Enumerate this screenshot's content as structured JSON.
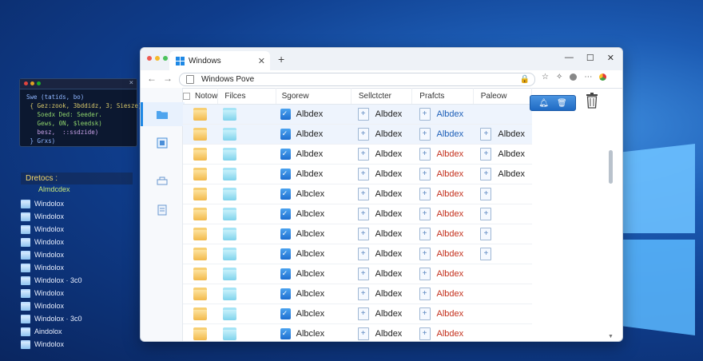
{
  "terminal": {
    "lines": [
      "Swe (tatids, bo)",
      " { Gez:zook, 3bddidz, 3; Siesze)",
      "   Soedx Ded: Seeder.",
      "   Gews, 0N, $leedsk)",
      "   besz,  ::ssdzide)",
      " } Grxs)"
    ],
    "line_colors": [
      "#8fb6ff",
      "#d8c86a",
      "#8ed36b",
      "#8ed36b",
      "#c7a0e6",
      "#8fb6ff"
    ]
  },
  "desktop_panel": {
    "header": "Dretocs :",
    "subheader": "Almdcdex",
    "items": [
      "Windolox",
      "Windolox",
      "Windolox",
      "Windolox",
      "Windolox",
      "Windolox",
      "Windolox · 3c0",
      "Windolox",
      "Windolox",
      "Windolox · 3c0",
      "Aindolox",
      "Windolox"
    ]
  },
  "browser": {
    "tab_title": "Windows",
    "address": "Windows Pove",
    "controls": {
      "minimize": "—",
      "maximize": "☐",
      "close": "✕",
      "new_tab": "+",
      "tab_close": "✕"
    }
  },
  "grid": {
    "columns": [
      "Notow",
      "Filces",
      "Sgorew",
      "Sellctcter",
      "Prafcts",
      "Paleow"
    ],
    "rows": [
      {
        "c3": "Albdex",
        "c4": "Albdex",
        "c5": "Albdex",
        "c5_color": "blue",
        "c6": "",
        "hl": true
      },
      {
        "c3": "Albdex",
        "c4": "Albdex",
        "c5": "Albdex",
        "c5_color": "blue",
        "c6": "Albdex",
        "hl": true
      },
      {
        "c3": "Albdex",
        "c4": "Albdex",
        "c5": "Albdex",
        "c5_color": "red",
        "c6": "Albdex",
        "hl": false
      },
      {
        "c3": "Albdex",
        "c4": "Albdex",
        "c5": "Albdex",
        "c5_color": "red",
        "c6": "Albdex",
        "hl": false
      },
      {
        "c3": "Albclex",
        "c4": "Albdex",
        "c5": "Albdex",
        "c5_color": "red",
        "c6": "",
        "hl": false
      },
      {
        "c3": "Albclex",
        "c4": "Albdex",
        "c5": "Albdex",
        "c5_color": "red",
        "c6": "",
        "hl": false
      },
      {
        "c3": "Albclex",
        "c4": "Albdex",
        "c5": "Albdex",
        "c5_color": "red",
        "c6": "",
        "hl": false
      },
      {
        "c3": "Albclex",
        "c4": "Albdex",
        "c5": "Albdex",
        "c5_color": "red",
        "c6": "",
        "hl": false
      },
      {
        "c3": "Albclex",
        "c4": "Albdex",
        "c5": "Albdex",
        "c5_color": "red",
        "c6": "",
        "hl": false
      },
      {
        "c3": "Albclex",
        "c4": "Albdex",
        "c5": "Albdex",
        "c5_color": "red",
        "c6": "",
        "hl": false
      },
      {
        "c3": "Albclex",
        "c4": "Albdex",
        "c5": "Albdex",
        "c5_color": "red",
        "c6": "",
        "hl": false
      },
      {
        "c3": "Albclex",
        "c4": "Albdex",
        "c5": "Albdex",
        "c5_color": "red",
        "c6": "",
        "hl": false
      }
    ],
    "c6_icon_rows": 8
  },
  "colors": {
    "accent": "#1e88e5",
    "red_text": "#c4301c",
    "blue_text": "#1d5fb8"
  },
  "icons": [
    "folder-icon",
    "document-icon",
    "printer-icon",
    "list-icon",
    "trash-icon",
    "lock-icon",
    "star-icon",
    "chrome-icon"
  ]
}
